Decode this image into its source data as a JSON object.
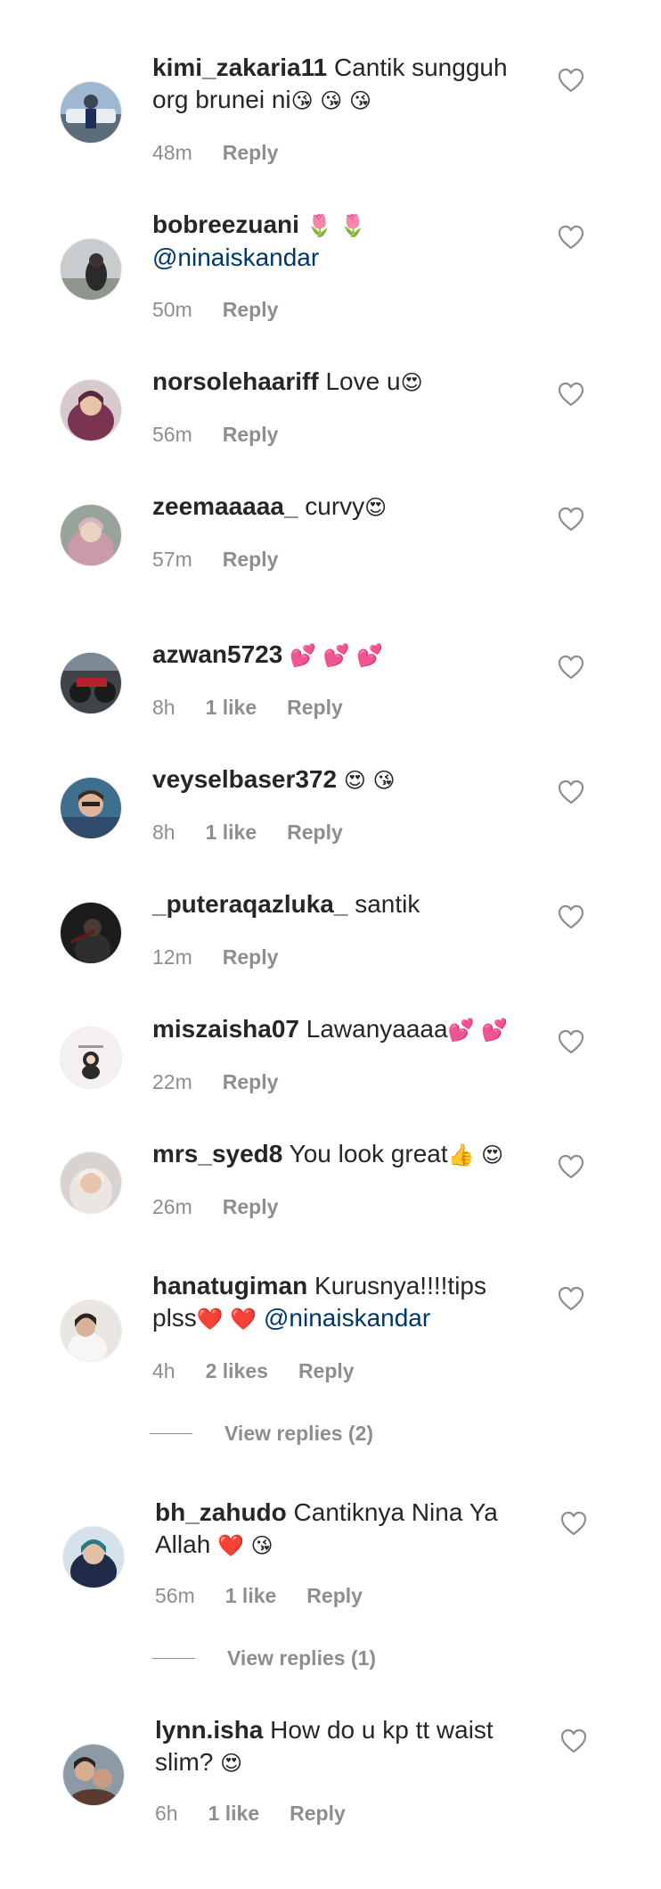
{
  "comments": [
    {
      "username": "kimi_zakaria11",
      "text": "Cantik sungguh org brunei ni",
      "emoji": "😘 😘 😘",
      "time": "48m",
      "reply": "Reply"
    },
    {
      "username": "bobreezuani",
      "text": "",
      "emoji": "🌷 🌷",
      "mention": "@ninaiskandar",
      "time": "50m",
      "reply": "Reply"
    },
    {
      "username": "norsolehaariff",
      "text": "Love u",
      "emoji": "😍",
      "time": "56m",
      "reply": "Reply"
    },
    {
      "username": "zeemaaaaa_",
      "text": "curvy",
      "emoji": "😍",
      "time": "57m",
      "reply": "Reply"
    },
    {
      "username": "azwan5723",
      "text": "",
      "emoji": "💕 💕 💕",
      "time": "8h",
      "likes": "1 like",
      "reply": "Reply"
    },
    {
      "username": "veyselbaser372",
      "text": "",
      "emoji": "😍 😘",
      "time": "8h",
      "likes": "1 like",
      "reply": "Reply"
    },
    {
      "username": "_puteraqazluka_",
      "text": "santik",
      "emoji": "",
      "time": "12m",
      "reply": "Reply"
    },
    {
      "username": "miszaisha07",
      "text": "Lawanyaaaa",
      "emoji": "💕 💕",
      "time": "22m",
      "reply": "Reply"
    },
    {
      "username": "mrs_syed8",
      "text": "You look great",
      "emoji": "👍 😍",
      "time": "26m",
      "reply": "Reply"
    },
    {
      "username": "hanatugiman",
      "text": "Kurusnya!!!!tips plss",
      "emoji": "❤️ ❤️",
      "mention": "@ninaiskandar",
      "time": "4h",
      "likes": "2 likes",
      "reply": "Reply",
      "view_replies": "View replies (2)"
    },
    {
      "username": "bh_zahudo",
      "text": "Cantiknya Nina Ya Allah",
      "emoji": "❤️ 😘",
      "time": "56m",
      "likes": "1 like",
      "reply": "Reply",
      "view_replies": "View replies (1)"
    },
    {
      "username": "lynn.isha",
      "text": "How do u kp tt waist slim?",
      "emoji": "😍",
      "time": "6h",
      "likes": "1 like",
      "reply": "Reply"
    }
  ],
  "icons": {
    "like": "heart-outline-icon"
  },
  "colors": {
    "text": "#262626",
    "muted": "#8e8e8e",
    "mention": "#00376b"
  }
}
